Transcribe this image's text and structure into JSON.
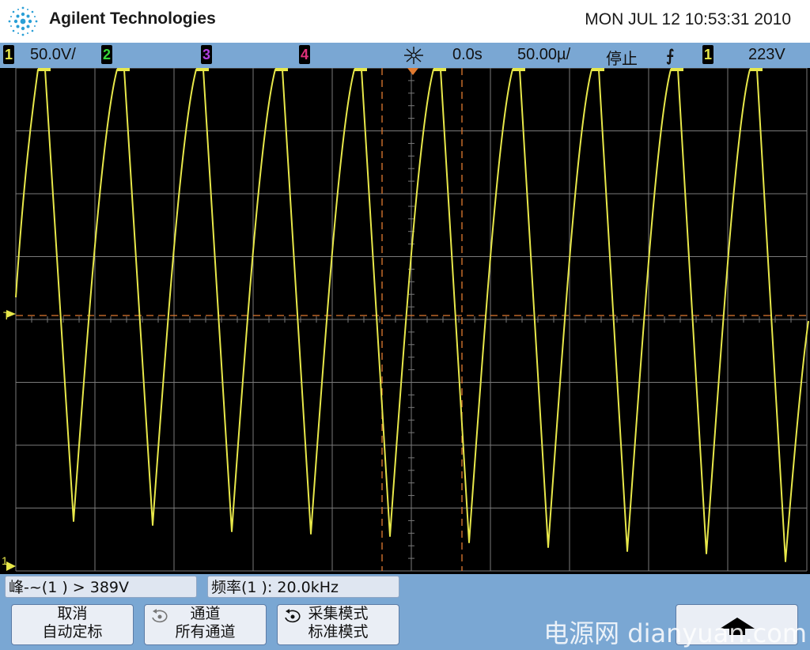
{
  "header": {
    "brand": "Agilent Technologies",
    "datetime": "MON JUL 12 10:53:31 2010"
  },
  "status_bar": {
    "ch1_label": "1",
    "ch1_scale": "50.0V/",
    "ch2_label": "2",
    "ch3_label": "3",
    "ch4_label": "4",
    "time_offset": "0.0s",
    "time_scale": "50.00µ/",
    "run_state": "停止",
    "trigger_slope_glyph": "⨍",
    "trigger_source": "1",
    "trigger_level": "223V"
  },
  "screen": {
    "trigger_marker": "T",
    "ground_marker": "1",
    "colors": {
      "trace": "#e8e84a",
      "grid": "#7a7a7a",
      "cursor": "#e07a30",
      "ch1": "#e8e84a",
      "ch2": "#36d63a",
      "ch3": "#b040e0",
      "ch4": "#e0307a"
    }
  },
  "measurements": {
    "peak": "峰-~(1 ) > 389V",
    "frequency": "频率(1 ): 20.0kHz"
  },
  "softkeys": [
    {
      "line1": "取消",
      "line2": "自动定标"
    },
    {
      "line1": "通道",
      "line2": "所有通道"
    },
    {
      "line1": "采集模式",
      "line2": "标准模式"
    }
  ],
  "watermark": "电源网  dianyuan.com"
}
